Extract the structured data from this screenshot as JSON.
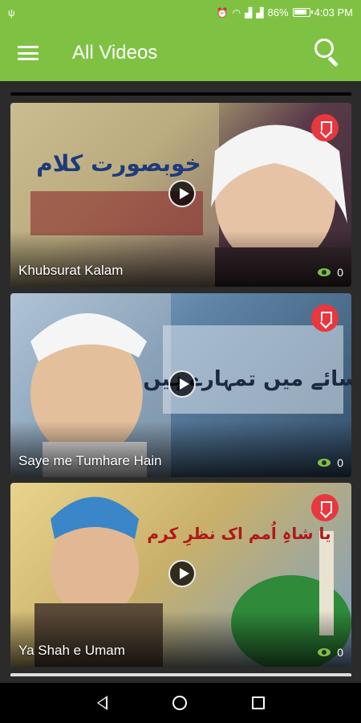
{
  "status_bar": {
    "percent": "86%",
    "time": "4:03 PM",
    "icons": [
      "usb-icon",
      "alarm-icon",
      "wifi-icon",
      "signal-icon",
      "battery-icon"
    ]
  },
  "app_bar": {
    "title": "All Videos",
    "menu_icon": "hamburger-icon",
    "search_icon": "search-icon",
    "color": "#7fc243"
  },
  "videos": [
    {
      "title": "Khubsurat Kalam",
      "views": "0",
      "thumbnail_text": "خوبصورت کلام"
    },
    {
      "title": "Saye me Tumhare Hain",
      "views": "0",
      "thumbnail_text": "سائے میں تمہارے ہیں"
    },
    {
      "title": "Ya Shah e Umam",
      "views": "0",
      "thumbnail_text": "یا شاہِ اُمم اک نظرِ کرم"
    }
  ],
  "nav_bar": {
    "icons": [
      "back-icon",
      "home-icon",
      "recents-icon"
    ]
  },
  "colors": {
    "accent": "#7fc243",
    "bookmark": "#e8373f",
    "background": "#2b2b2b"
  }
}
